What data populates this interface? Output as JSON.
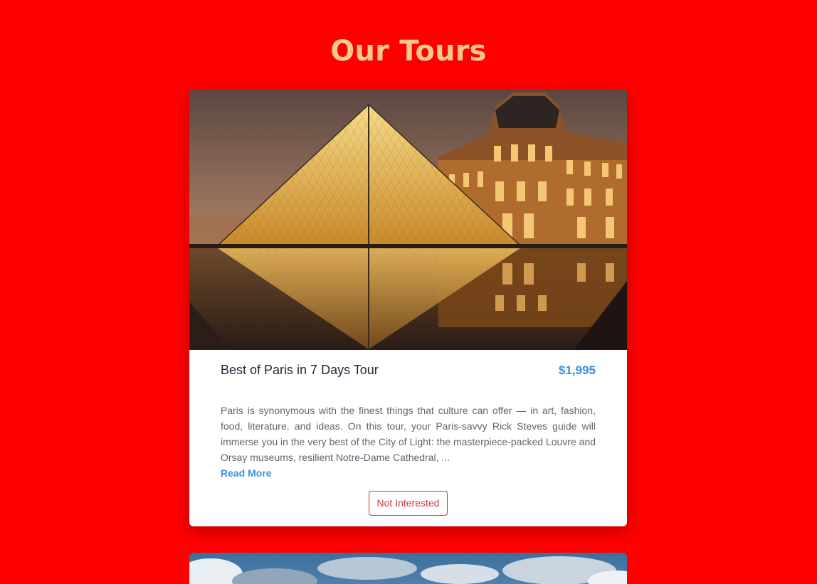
{
  "page": {
    "title": "Our Tours"
  },
  "tours": [
    {
      "image": "louvre-pyramid-photo",
      "name": "Best of Paris in 7 Days Tour",
      "price": "$1,995",
      "description": "Paris is synonymous with the finest things that culture can offer — in art, fashion, food, literature, and ideas. On this tour, your Paris-savvy Rick Steves guide will immerse you in the very best of the City of Light: the masterpiece-packed Louvre and Orsay museums, resilient Notre-Dame Cathedral, ...",
      "read_more_label": "Read More",
      "not_interested_label": "Not Interested"
    },
    {
      "image": "sky-clouds-photo"
    }
  ],
  "colors": {
    "background": "#ff0000",
    "title": "#f8c98f",
    "accent": "#3b8fe0",
    "danger": "#d0333f"
  }
}
